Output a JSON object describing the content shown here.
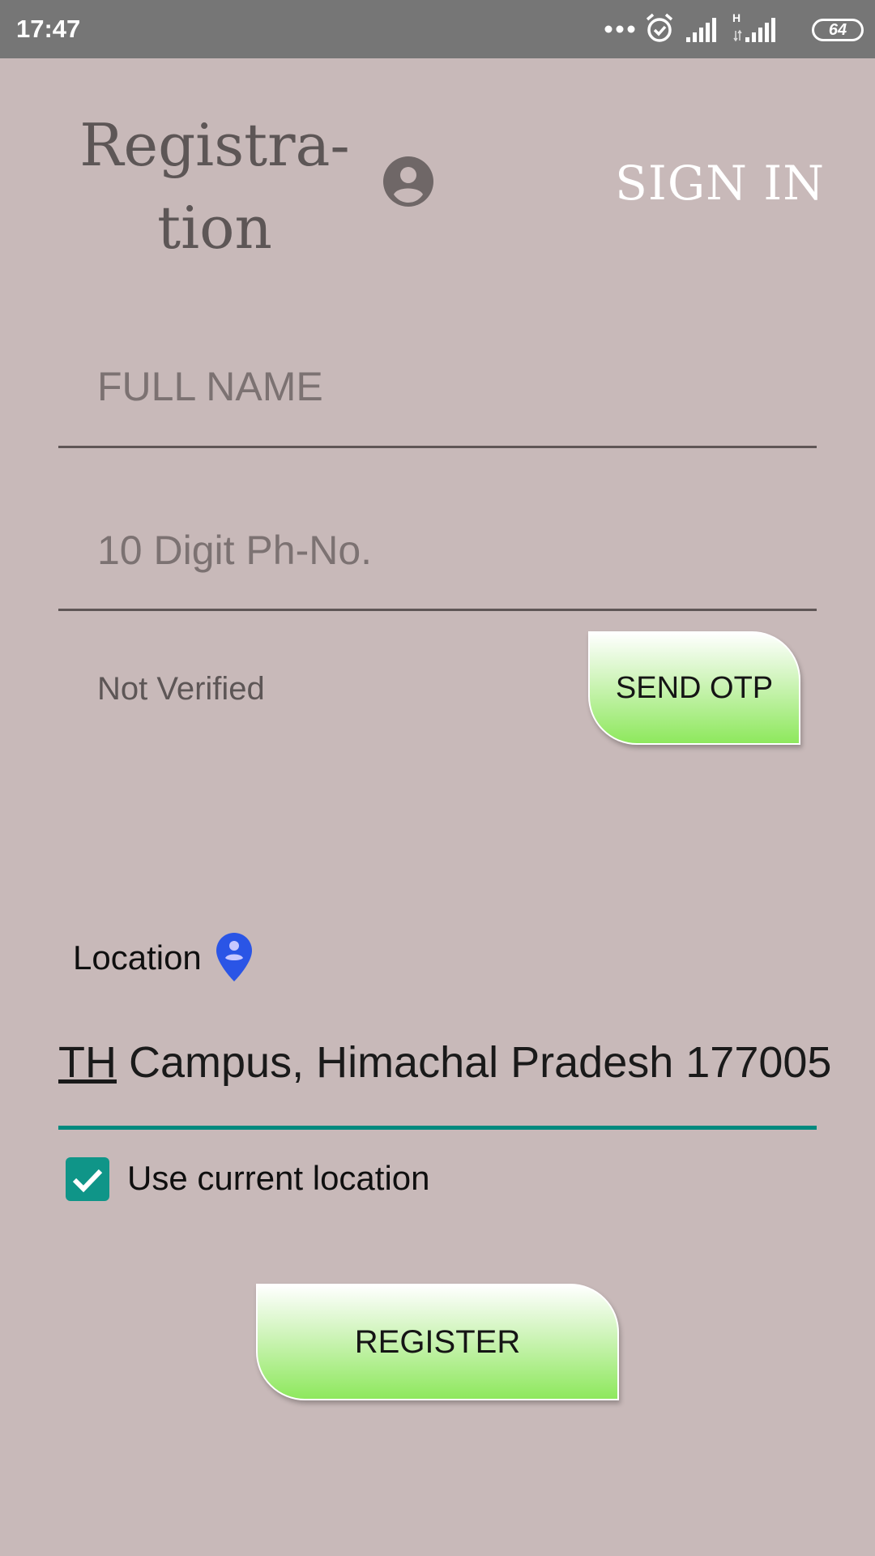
{
  "status_bar": {
    "time": "17:47",
    "network_type": "H",
    "battery": "64",
    "icons": [
      "more-dots-icon",
      "alarm-icon",
      "signal-icon",
      "signal-h-icon",
      "battery-icon"
    ]
  },
  "header": {
    "title_line1": "Registra-",
    "title_line2": "tion",
    "icon": "account-circle-icon",
    "signin_label": "SIGN IN"
  },
  "form": {
    "fullname_placeholder": "FULL NAME",
    "phone_placeholder": "10 Digit Ph-No.",
    "verification_status": "Not Verified",
    "send_otp_label": "SEND OTP",
    "location_label": "Location",
    "location_icon": "location-pin-icon",
    "location_value_underlined": "TH",
    "location_value_rest": " Campus, Himachal Pradesh 177005",
    "use_current_location_label": "Use current location",
    "use_current_location_checked": true,
    "register_label": "REGISTER"
  },
  "colors": {
    "background": "#c8b9b9",
    "status_bar": "#767676",
    "accent_teal": "#0f9588",
    "button_green": "#8ee85d",
    "pin_blue": "#2a55e6"
  }
}
